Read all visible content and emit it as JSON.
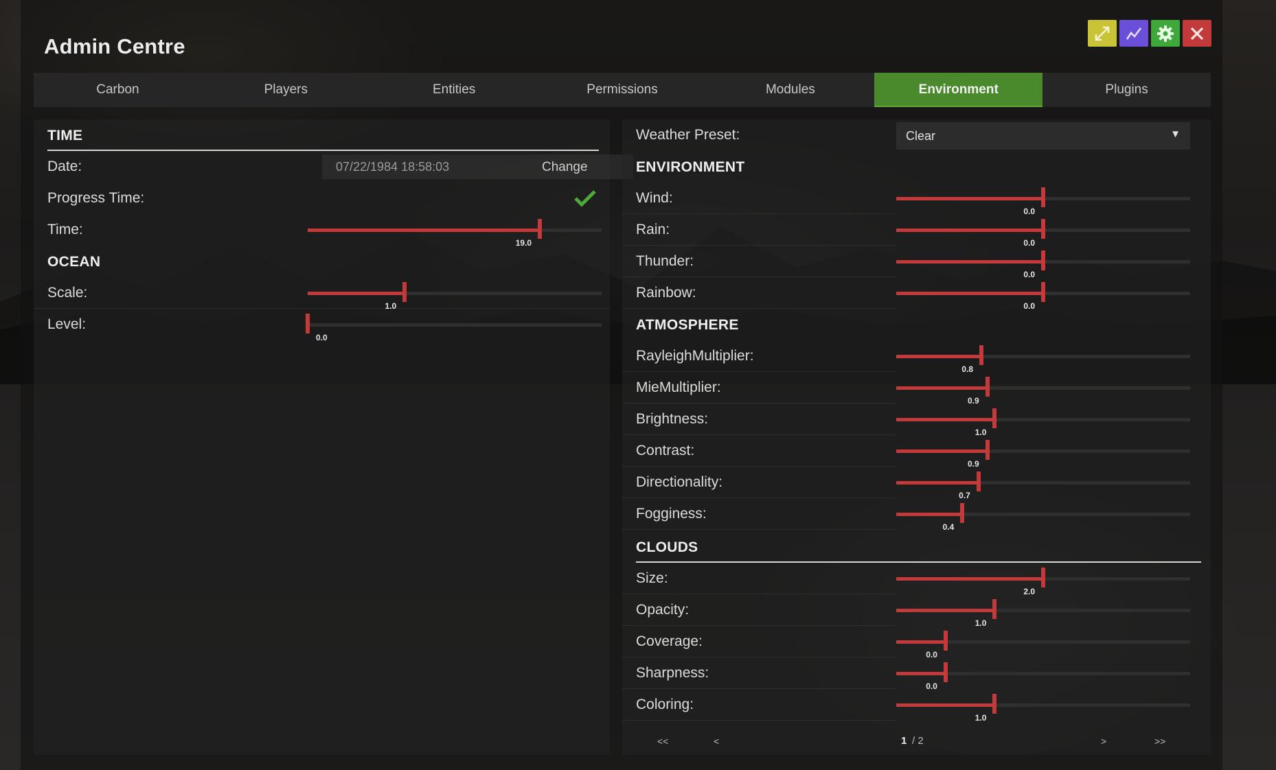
{
  "window": {
    "title": "Admin Centre"
  },
  "title_buttons": [
    {
      "name": "maximize-button",
      "icon": "expand-icon",
      "color": "#c9c437"
    },
    {
      "name": "graph-button",
      "icon": "line-chart-icon",
      "color": "#6b4fd8"
    },
    {
      "name": "settings-button",
      "icon": "gear-icon",
      "color": "#3ea83b"
    },
    {
      "name": "close-button",
      "icon": "close-icon",
      "color": "#c33a3a"
    }
  ],
  "tabs": [
    "Carbon",
    "Players",
    "Entities",
    "Permissions",
    "Modules",
    "Environment",
    "Plugins"
  ],
  "active_tab": "Environment",
  "colors": {
    "accent_green": "#4b8a2c",
    "slider_red": "#c43a3a"
  },
  "left": {
    "time_section": "TIME",
    "date_label": "Date:",
    "date_value": "07/22/1984 18:58:03",
    "change_label": "Change",
    "progress_label": "Progress Time:",
    "progress_checked": true,
    "time_label": "Time:",
    "time_value": "19.0",
    "time_fraction": 0.79,
    "ocean_section": "OCEAN",
    "scale_label": "Scale:",
    "scale_value": "1.0",
    "scale_fraction": 0.33,
    "level_label": "Level:",
    "level_value": "0.0",
    "level_fraction": 0.0
  },
  "right": {
    "weather_preset_label": "Weather Preset:",
    "weather_preset_value": "Clear",
    "dropdown_arrow": "▼",
    "environment_section": "ENVIRONMENT",
    "env_rows": [
      {
        "label": "Wind:",
        "value": "0.0",
        "fraction": 0.5
      },
      {
        "label": "Rain:",
        "value": "0.0",
        "fraction": 0.5
      },
      {
        "label": "Thunder:",
        "value": "0.0",
        "fraction": 0.5
      },
      {
        "label": "Rainbow:",
        "value": "0.0",
        "fraction": 0.5
      }
    ],
    "atmosphere_section": "ATMOSPHERE",
    "atmo_rows": [
      {
        "label": "RayleighMultiplier:",
        "value": "0.8",
        "fraction": 0.29
      },
      {
        "label": "MieMultiplier:",
        "value": "0.9",
        "fraction": 0.31
      },
      {
        "label": "Brightness:",
        "value": "1.0",
        "fraction": 0.335
      },
      {
        "label": "Contrast:",
        "value": "0.9",
        "fraction": 0.31
      },
      {
        "label": "Directionality:",
        "value": "0.7",
        "fraction": 0.28
      },
      {
        "label": "Fogginess:",
        "value": "0.4",
        "fraction": 0.225
      }
    ],
    "clouds_section": "CLOUDS",
    "cloud_rows": [
      {
        "label": "Size:",
        "value": "2.0",
        "fraction": 0.5
      },
      {
        "label": "Opacity:",
        "value": "1.0",
        "fraction": 0.335
      },
      {
        "label": "Coverage:",
        "value": "0.0",
        "fraction": 0.168
      },
      {
        "label": "Sharpness:",
        "value": "0.0",
        "fraction": 0.168
      },
      {
        "label": "Coloring:",
        "value": "1.0",
        "fraction": 0.335
      }
    ]
  },
  "pager": {
    "first": "<<",
    "prev": "<",
    "current": "1",
    "total": "/ 2",
    "next": ">",
    "last": ">>"
  }
}
